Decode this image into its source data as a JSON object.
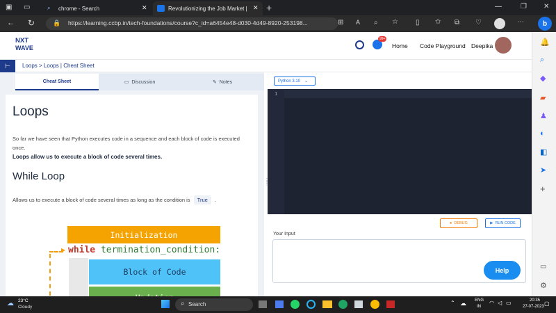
{
  "browser": {
    "tabs": [
      {
        "label": "chrome - Search"
      },
      {
        "label": "Revolutionizing the Job Market |"
      }
    ],
    "url": "https://learning.ccbp.in/tech-foundations/course?c_id=a6454e48-d030-4d49-8920-253198..."
  },
  "site": {
    "logo_line1": "NXT",
    "logo_line2": "WAVE",
    "notification_badge": "99+",
    "nav": {
      "home": "Home",
      "playground": "Code Playground",
      "user": "Deepika"
    }
  },
  "breadcrumb": "Loops > Loops | Cheat Sheet",
  "panel_tabs": {
    "cheat": "Cheat Sheet",
    "discussion": "Discussion",
    "notes": "Notes"
  },
  "content": {
    "title": "Loops",
    "para1": "So far we have seen that Python executes code in a sequence and each block of code is executed once.",
    "para2_bold": "Loops allow us to execute a block of code several times.",
    "subtitle": "While Loop",
    "para3": "Allows us to execute a block of code several times as long as the condition is",
    "para3_code": "True",
    "para3_end": ".",
    "diagram": {
      "init": "Initialization",
      "while_kw": "while",
      "condition": "termination_condition:",
      "block": "Block of Code",
      "update": "Updation"
    }
  },
  "editor": {
    "language": "Python 3.10",
    "line_no": "1",
    "debug": "DEBUG",
    "run": "RUN CODE",
    "input_label": "Your Input",
    "help": "Help"
  },
  "taskbar": {
    "temp": "23°C",
    "weather": "Cloudy",
    "search": "Search",
    "lang1": "ENG",
    "lang2": "IN",
    "time": "20:35",
    "date": "27-07-2023"
  },
  "colors": {
    "accent": "#1a73e8",
    "orange": "#f59e0b",
    "blue_block": "#4fc3f7",
    "green_block": "#6ab04c",
    "dark_editor": "#1d2331"
  }
}
